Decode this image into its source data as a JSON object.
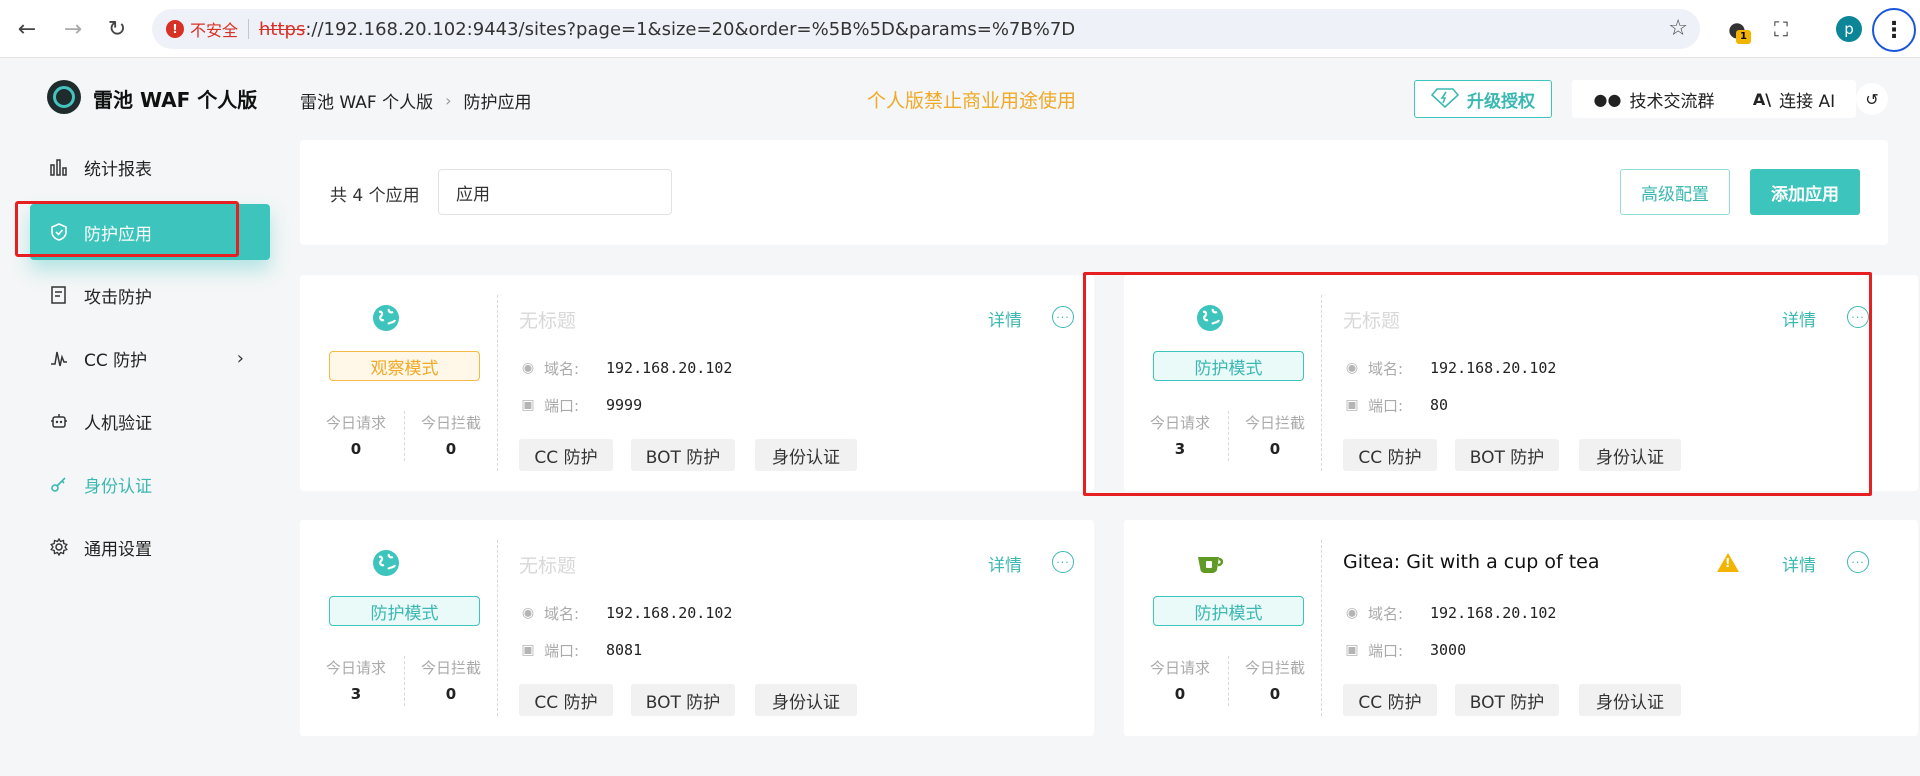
{
  "browser": {
    "security_label": "不安全",
    "url_scheme": "https",
    "url_rest": "://192.168.20.102:9443/sites?page=1&size=20&order=%5B%5D&params=%7B%7D",
    "extension_badge": "1",
    "profile_initial": "p"
  },
  "sidebar": {
    "brand": "雷池 WAF 个人版",
    "items": [
      {
        "label": "统计报表",
        "icon": "bar-chart-icon"
      },
      {
        "label": "防护应用",
        "icon": "shield-icon"
      },
      {
        "label": "攻击防护",
        "icon": "document-icon"
      },
      {
        "label": "CC 防护",
        "icon": "pulse-icon"
      },
      {
        "label": "人机验证",
        "icon": "robot-icon"
      },
      {
        "label": "身份认证",
        "icon": "key-icon"
      },
      {
        "label": "通用设置",
        "icon": "gear-icon"
      }
    ]
  },
  "header": {
    "breadcrumb_root": "雷池 WAF 个人版",
    "breadcrumb_current": "防护应用",
    "notice": "个人版禁止商业用途使用",
    "upgrade_label": "升级授权",
    "group_label": "技术交流群",
    "ai_label": "连接 AI"
  },
  "toolbar": {
    "total": "共 4 个应用",
    "search_value": "应用",
    "advanced_label": "高级配置",
    "add_label": "添加应用"
  },
  "labels": {
    "detail": "详情",
    "today_requests": "今日请求",
    "today_blocked": "今日拦截",
    "domain": "域名:",
    "port": "端口:"
  },
  "cards": [
    {
      "title": "无标题",
      "mode": "观察模式",
      "requests": "0",
      "blocked": "0",
      "domain": "192.168.20.102",
      "port": "9999",
      "tags": [
        "CC 防护",
        "BOT 防护",
        "身份认证"
      ]
    },
    {
      "title": "无标题",
      "mode": "防护模式",
      "requests": "3",
      "blocked": "0",
      "domain": "192.168.20.102",
      "port": "80",
      "tags": [
        "CC 防护",
        "BOT 防护",
        "身份认证"
      ]
    },
    {
      "title": "无标题",
      "mode": "防护模式",
      "requests": "3",
      "blocked": "0",
      "domain": "192.168.20.102",
      "port": "8081",
      "tags": [
        "CC 防护",
        "BOT 防护",
        "身份认证"
      ]
    },
    {
      "title": "Gitea: Git with a cup of tea",
      "mode": "防护模式",
      "requests": "0",
      "blocked": "0",
      "domain": "192.168.20.102",
      "port": "3000",
      "tags": [
        "CC 防护",
        "BOT 防护",
        "身份认证"
      ]
    }
  ],
  "colors": {
    "accent": "#3cc4bd",
    "watch_mode": "#f0a928",
    "highlight_box": "#e62020"
  }
}
